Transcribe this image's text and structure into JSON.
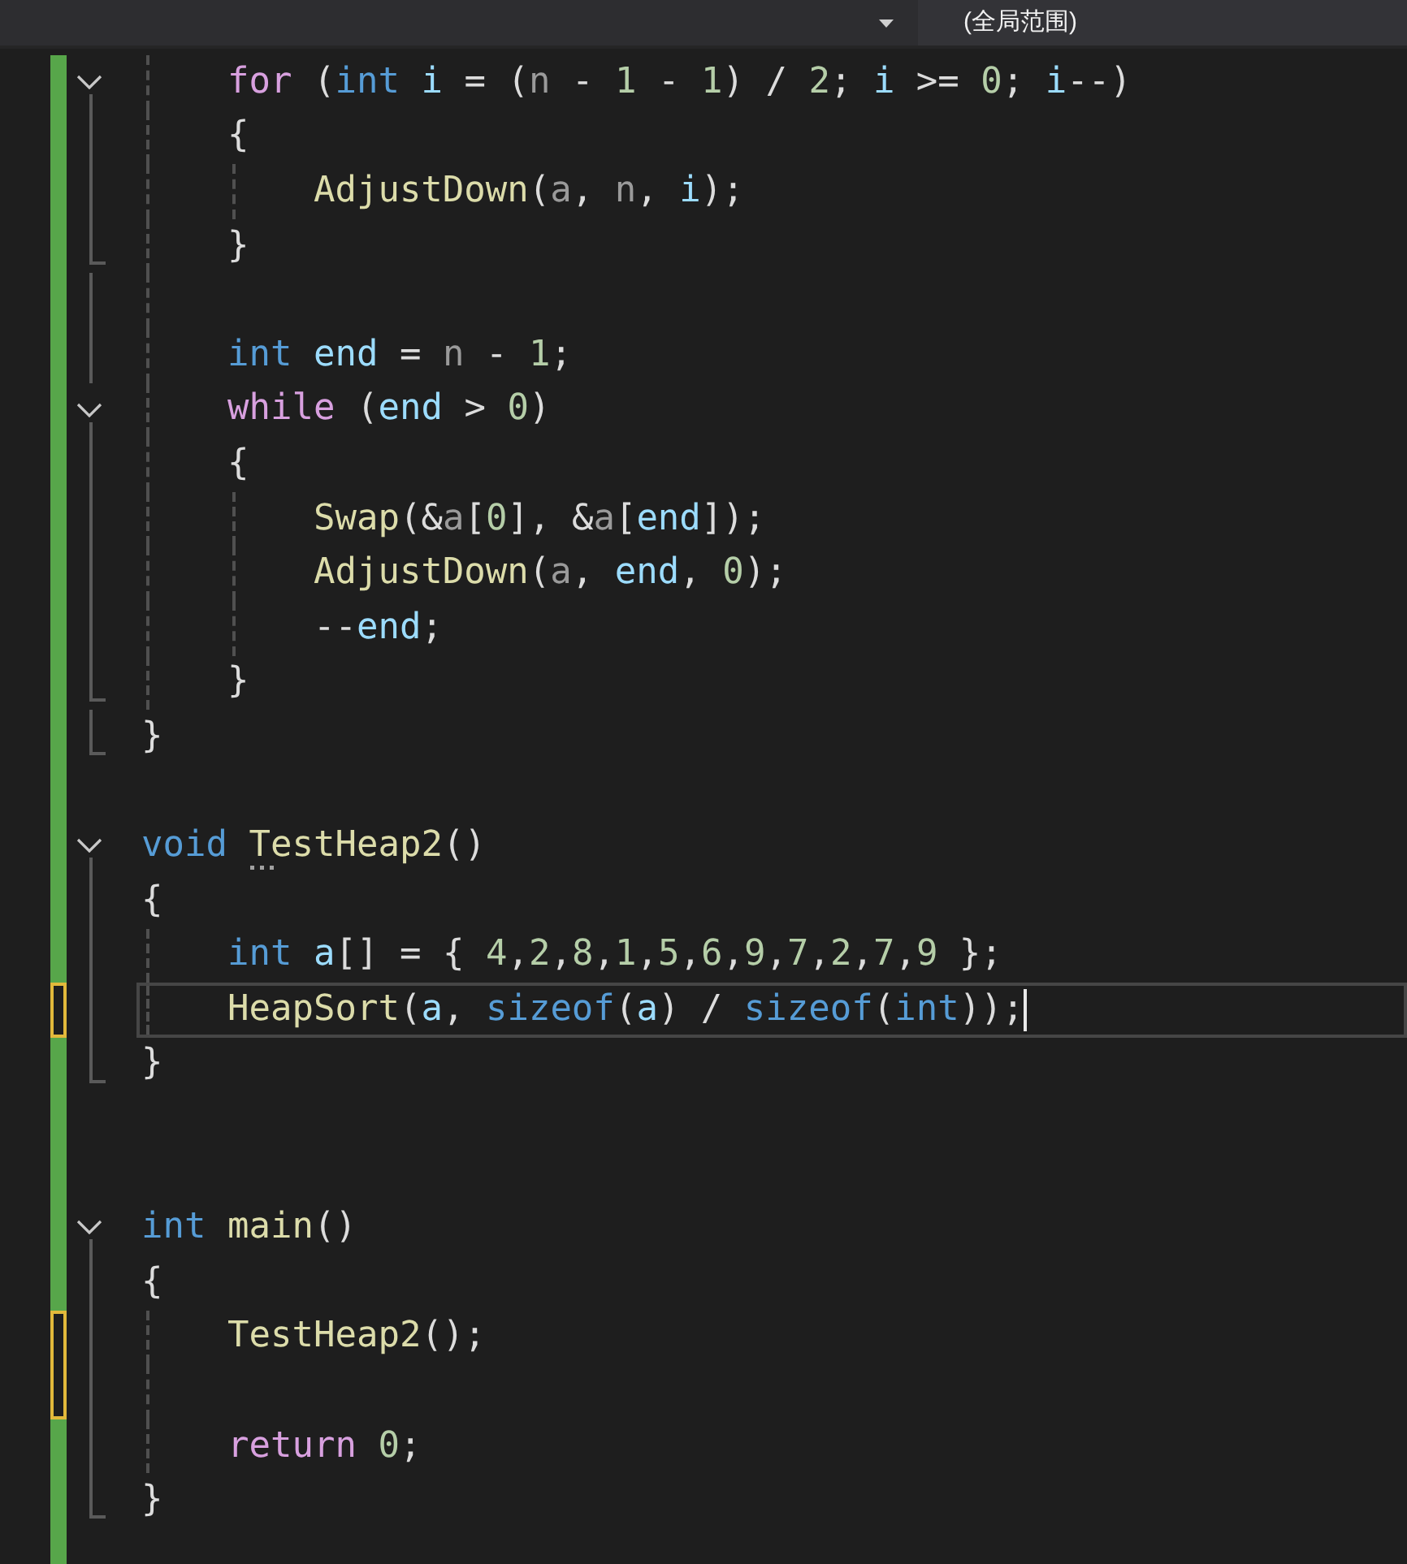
{
  "toolbar": {
    "scope": "(全局范围)"
  },
  "lines": [
    {
      "kind": "fold-start",
      "modified": false,
      "current": false,
      "tokens": [
        {
          "t": "    for",
          "kind": "control"
        },
        {
          "t": " (",
          "kind": "plain"
        },
        {
          "t": "int",
          "kind": "keyword"
        },
        {
          "t": " i",
          "kind": "local"
        },
        {
          "t": " = (",
          "kind": "plain"
        },
        {
          "t": "n",
          "kind": "parameter"
        },
        {
          "t": " - ",
          "kind": "plain"
        },
        {
          "t": "1",
          "kind": "number"
        },
        {
          "t": " - ",
          "kind": "plain"
        },
        {
          "t": "1",
          "kind": "number"
        },
        {
          "t": ") / ",
          "kind": "plain"
        },
        {
          "t": "2",
          "kind": "number"
        },
        {
          "t": "; ",
          "kind": "plain"
        },
        {
          "t": "i",
          "kind": "local"
        },
        {
          "t": " >= ",
          "kind": "plain"
        },
        {
          "t": "0",
          "kind": "number"
        },
        {
          "t": "; ",
          "kind": "plain"
        },
        {
          "t": "i",
          "kind": "local"
        },
        {
          "t": "--)",
          "kind": "plain"
        }
      ]
    },
    {
      "kind": "body",
      "modified": false,
      "current": false,
      "tokens": [
        {
          "t": "    {",
          "kind": "plain"
        }
      ]
    },
    {
      "kind": "body",
      "modified": false,
      "current": false,
      "tokens": [
        {
          "t": "        AdjustDown",
          "kind": "function"
        },
        {
          "t": "(",
          "kind": "plain"
        },
        {
          "t": "a",
          "kind": "parameter"
        },
        {
          "t": ", ",
          "kind": "plain"
        },
        {
          "t": "n",
          "kind": "parameter"
        },
        {
          "t": ", ",
          "kind": "plain"
        },
        {
          "t": "i",
          "kind": "local"
        },
        {
          "t": ");",
          "kind": "plain"
        }
      ]
    },
    {
      "kind": "fold-end",
      "modified": false,
      "current": false,
      "tokens": [
        {
          "t": "    }",
          "kind": "plain"
        }
      ]
    },
    {
      "kind": "body",
      "modified": false,
      "current": false
    },
    {
      "kind": "body",
      "modified": false,
      "current": false,
      "tokens": [
        {
          "t": "    int",
          "kind": "keyword"
        },
        {
          "t": " end",
          "kind": "local"
        },
        {
          "t": " = ",
          "kind": "plain"
        },
        {
          "t": "n",
          "kind": "parameter"
        },
        {
          "t": " - ",
          "kind": "plain"
        },
        {
          "t": "1",
          "kind": "number"
        },
        {
          "t": ";",
          "kind": "plain"
        }
      ]
    },
    {
      "kind": "fold-start",
      "modified": false,
      "current": false,
      "tokens": [
        {
          "t": "    while",
          "kind": "control"
        },
        {
          "t": " (",
          "kind": "plain"
        },
        {
          "t": "end",
          "kind": "local"
        },
        {
          "t": " > ",
          "kind": "plain"
        },
        {
          "t": "0",
          "kind": "number"
        },
        {
          "t": ")",
          "kind": "plain"
        }
      ]
    },
    {
      "kind": "body",
      "modified": false,
      "current": false,
      "tokens": [
        {
          "t": "    {",
          "kind": "plain"
        }
      ]
    },
    {
      "kind": "body",
      "modified": false,
      "current": false,
      "tokens": [
        {
          "t": "        Swap",
          "kind": "function"
        },
        {
          "t": "(&",
          "kind": "plain"
        },
        {
          "t": "a",
          "kind": "parameter"
        },
        {
          "t": "[",
          "kind": "plain"
        },
        {
          "t": "0",
          "kind": "number"
        },
        {
          "t": "], &",
          "kind": "plain"
        },
        {
          "t": "a",
          "kind": "parameter"
        },
        {
          "t": "[",
          "kind": "plain"
        },
        {
          "t": "end",
          "kind": "local"
        },
        {
          "t": "]);",
          "kind": "plain"
        }
      ]
    },
    {
      "kind": "body",
      "modified": false,
      "current": false,
      "tokens": [
        {
          "t": "        AdjustDown",
          "kind": "function"
        },
        {
          "t": "(",
          "kind": "plain"
        },
        {
          "t": "a",
          "kind": "parameter"
        },
        {
          "t": ", ",
          "kind": "plain"
        },
        {
          "t": "end",
          "kind": "local"
        },
        {
          "t": ", ",
          "kind": "plain"
        },
        {
          "t": "0",
          "kind": "number"
        },
        {
          "t": ");",
          "kind": "plain"
        }
      ]
    },
    {
      "kind": "body",
      "modified": false,
      "current": false,
      "tokens": [
        {
          "t": "        --",
          "kind": "plain"
        },
        {
          "t": "end",
          "kind": "local"
        },
        {
          "t": ";",
          "kind": "plain"
        }
      ]
    },
    {
      "kind": "fold-end",
      "modified": false,
      "current": false,
      "tokens": [
        {
          "t": "    }",
          "kind": "plain"
        }
      ]
    },
    {
      "kind": "fold-end",
      "modified": false,
      "current": false,
      "tokens": [
        {
          "t": "}",
          "kind": "plain"
        }
      ]
    },
    {
      "kind": "none",
      "modified": false,
      "current": false
    },
    {
      "kind": "fold-start",
      "modified": false,
      "current": false,
      "tokens": [
        {
          "t": "void ",
          "kind": "keyword"
        },
        {
          "t": "TestHeap2",
          "kind": "function",
          "hint": true
        },
        {
          "t": "()",
          "kind": "plain"
        }
      ]
    },
    {
      "kind": "body",
      "modified": false,
      "current": false,
      "tokens": [
        {
          "t": "{",
          "kind": "plain"
        }
      ]
    },
    {
      "kind": "body",
      "modified": false,
      "current": false,
      "tokens": [
        {
          "t": "    int",
          "kind": "keyword"
        },
        {
          "t": " a",
          "kind": "local"
        },
        {
          "t": "[] = { ",
          "kind": "plain"
        },
        {
          "t": "4",
          "kind": "number"
        },
        {
          "t": ",",
          "kind": "plain"
        },
        {
          "t": "2",
          "kind": "number"
        },
        {
          "t": ",",
          "kind": "plain"
        },
        {
          "t": "8",
          "kind": "number"
        },
        {
          "t": ",",
          "kind": "plain"
        },
        {
          "t": "1",
          "kind": "number"
        },
        {
          "t": ",",
          "kind": "plain"
        },
        {
          "t": "5",
          "kind": "number"
        },
        {
          "t": ",",
          "kind": "plain"
        },
        {
          "t": "6",
          "kind": "number"
        },
        {
          "t": ",",
          "kind": "plain"
        },
        {
          "t": "9",
          "kind": "number"
        },
        {
          "t": ",",
          "kind": "plain"
        },
        {
          "t": "7",
          "kind": "number"
        },
        {
          "t": ",",
          "kind": "plain"
        },
        {
          "t": "2",
          "kind": "number"
        },
        {
          "t": ",",
          "kind": "plain"
        },
        {
          "t": "7",
          "kind": "number"
        },
        {
          "t": ",",
          "kind": "plain"
        },
        {
          "t": "9",
          "kind": "number"
        },
        {
          "t": " };",
          "kind": "plain"
        }
      ]
    },
    {
      "kind": "body",
      "modified": true,
      "current": true,
      "tokens": [
        {
          "t": "    HeapSort",
          "kind": "function"
        },
        {
          "t": "(",
          "kind": "plain"
        },
        {
          "t": "a",
          "kind": "local"
        },
        {
          "t": ", ",
          "kind": "plain"
        },
        {
          "t": "sizeof",
          "kind": "keyword"
        },
        {
          "t": "(",
          "kind": "plain"
        },
        {
          "t": "a",
          "kind": "local"
        },
        {
          "t": ") / ",
          "kind": "plain"
        },
        {
          "t": "sizeof",
          "kind": "keyword"
        },
        {
          "t": "(",
          "kind": "plain"
        },
        {
          "t": "int",
          "kind": "keyword"
        },
        {
          "t": "));",
          "kind": "plain"
        }
      ]
    },
    {
      "kind": "fold-end",
      "modified": false,
      "current": false,
      "tokens": [
        {
          "t": "}",
          "kind": "plain"
        }
      ]
    },
    {
      "kind": "none",
      "modified": false,
      "current": false
    },
    {
      "kind": "none",
      "modified": false,
      "current": false
    },
    {
      "kind": "fold-start",
      "modified": false,
      "current": false,
      "tokens": [
        {
          "t": "int ",
          "kind": "keyword"
        },
        {
          "t": "main",
          "kind": "function"
        },
        {
          "t": "()",
          "kind": "plain"
        }
      ]
    },
    {
      "kind": "body",
      "modified": false,
      "current": false,
      "tokens": [
        {
          "t": "{",
          "kind": "plain"
        }
      ]
    },
    {
      "kind": "body",
      "modified": true,
      "current": false,
      "tokens": [
        {
          "t": "    TestHeap2",
          "kind": "function"
        },
        {
          "t": "();",
          "kind": "plain"
        }
      ]
    },
    {
      "kind": "body",
      "modified": true,
      "current": false
    },
    {
      "kind": "body",
      "modified": false,
      "current": false,
      "tokens": [
        {
          "t": "    return ",
          "kind": "control"
        },
        {
          "t": "0",
          "kind": "number"
        },
        {
          "t": ";",
          "kind": "plain"
        }
      ]
    },
    {
      "kind": "fold-end",
      "modified": false,
      "current": false,
      "tokens": [
        {
          "t": "}",
          "kind": "plain"
        }
      ]
    }
  ]
}
